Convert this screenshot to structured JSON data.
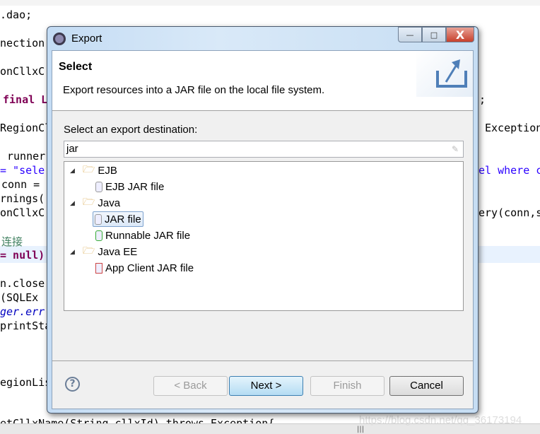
{
  "background_editor": {
    "lines_left": [
      ".dao;",
      "nection",
      "onCllxC",
      "final L",
      "RegionCl",
      "runner",
      "= \"sele",
      "conn =",
      "rnings(",
      "onCllxC",
      "连接",
      "= null)",
      "n.close",
      "(SQLEx",
      "ger.err",
      "printSta",
      "egionLis"
    ],
    "lines_right": [
      ";",
      "Exception",
      "el where c",
      "ery(conn,s"
    ],
    "bottom_line": "etCllxName(String cllxId) throws Exception{",
    "watermark": "https://blog.csdn.net/qq_36173194"
  },
  "dialog": {
    "title": "Export",
    "window_buttons": {
      "minimize": "—",
      "maximize": "□",
      "close": "X"
    },
    "header": {
      "title": "Select",
      "description": "Export resources into a JAR file on the local file system."
    },
    "destination_label": "Select an export destination:",
    "filter": {
      "value": "jar"
    },
    "tree": [
      {
        "label": "EJB",
        "expanded": true,
        "children": [
          {
            "label": "EJB JAR file",
            "selected": false
          }
        ]
      },
      {
        "label": "Java",
        "expanded": true,
        "children": [
          {
            "label": "JAR file",
            "selected": true
          },
          {
            "label": "Runnable JAR file",
            "selected": false
          }
        ]
      },
      {
        "label": "Java EE",
        "expanded": true,
        "children": [
          {
            "label": "App Client JAR file",
            "selected": false
          }
        ]
      }
    ],
    "buttons": {
      "help": "?",
      "back": "< Back",
      "next": "Next >",
      "finish": "Finish",
      "cancel": "Cancel"
    }
  }
}
